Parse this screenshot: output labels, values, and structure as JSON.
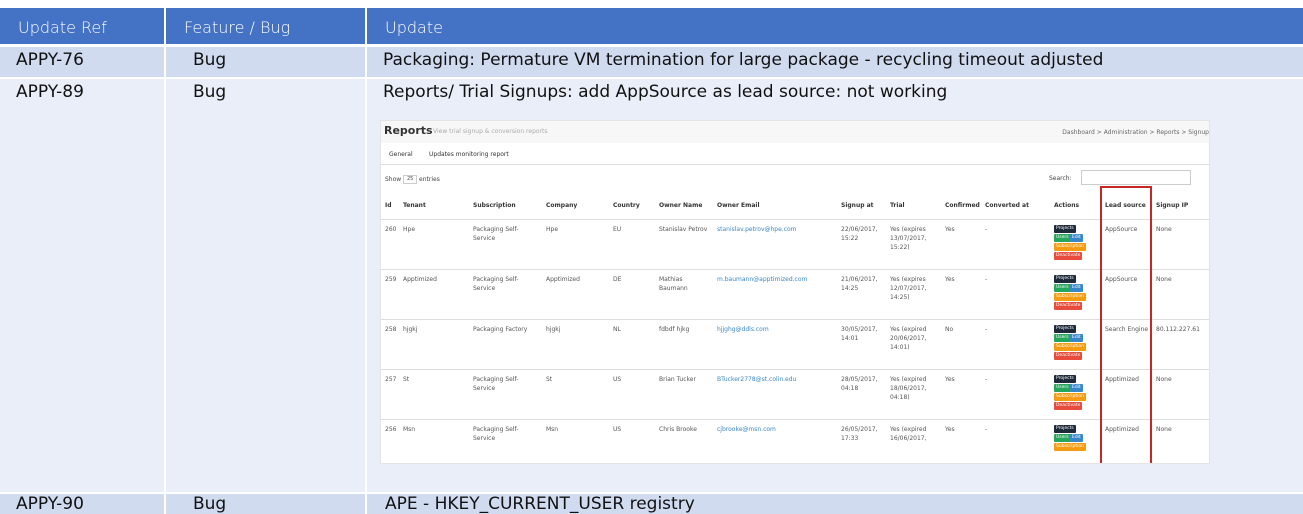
{
  "headers": [
    "Update Ref",
    "Feature / Bug",
    "Update"
  ],
  "rows": [
    {
      "ref": "APPY-76",
      "type": "Bug",
      "update": "Packaging: Permature VM termination for large package  - recycling timeout adjusted"
    },
    {
      "ref": "APPY-89",
      "type": "Bug",
      "update": "Reports/ Trial Signups: add AppSource as lead source: not working"
    },
    {
      "ref": "APPY-90",
      "type": "Bug",
      "update": "APE - HKEY_CURRENT_USER registry"
    }
  ],
  "screenshot": {
    "title": "Reports",
    "subtitle": "View trial signup & conversion reports",
    "breadcrumb": "Dashboard  >  Administration  >  Reports  >  Signup",
    "tabs": [
      "General",
      "Updates monitoring report"
    ],
    "show_label": "Show",
    "show_value": "25",
    "entries_label": "entries",
    "search_label": "Search:",
    "columns": [
      "Id",
      "Tenant",
      "Subscription",
      "Company",
      "Country",
      "Owner Name",
      "Owner Email",
      "Signup at",
      "Trial",
      "Confirmed",
      "Converted at",
      "Actions",
      "Lead source",
      "Signup IP"
    ],
    "buttons": {
      "projects": "Projects",
      "users": "Users",
      "edit": "Edit",
      "subscription": "Subscription",
      "deactivate": "Deactivate"
    },
    "records": [
      {
        "id": "260",
        "tenant": "Hpe",
        "subscription": "Packaging Self-Service",
        "company": "Hpe",
        "country": "EU",
        "owner": "Stanislav Petrov",
        "email": "stanislav.petrov@hpe.com",
        "signup": "22/06/2017, 15:22",
        "trial": "Yes (expires 13/07/2017, 15:22)",
        "confirmed": "Yes",
        "converted": "-",
        "lead": "AppSource",
        "ip": "None"
      },
      {
        "id": "259",
        "tenant": "Apptimized",
        "subscription": "Packaging Self-Service",
        "company": "Apptimized",
        "country": "DE",
        "owner": "Mathias Baumann",
        "email": "m.baumann@apptimized.com",
        "signup": "21/06/2017, 14:25",
        "trial": "Yes (expires 12/07/2017, 14:25)",
        "confirmed": "Yes",
        "converted": "-",
        "lead": "AppSource",
        "ip": "None"
      },
      {
        "id": "258",
        "tenant": "hjgkj",
        "subscription": "Packaging Factory",
        "company": "hjgkj",
        "country": "NL",
        "owner": "fdbdf hjkg",
        "email": "hjjghg@ddls.com",
        "signup": "30/05/2017, 14:01",
        "trial": "Yes (expired 20/06/2017, 14:01)",
        "confirmed": "No",
        "converted": "-",
        "lead": "Search Engine",
        "ip": "80.112.227.61"
      },
      {
        "id": "257",
        "tenant": "St",
        "subscription": "Packaging Self-Service",
        "company": "St",
        "country": "US",
        "owner": "Brian Tucker",
        "email": "BTucker2778@st.colin.edu",
        "signup": "28/05/2017, 04:18",
        "trial": "Yes (expired 18/06/2017, 04:18)",
        "confirmed": "Yes",
        "converted": "-",
        "lead": "Apptimized",
        "ip": "None"
      },
      {
        "id": "256",
        "tenant": "Msn",
        "subscription": "Packaging Self-Service",
        "company": "Msn",
        "country": "US",
        "owner": "Chris Brooke",
        "email": "cjbrooke@msn.com",
        "signup": "26/05/2017, 17:33",
        "trial": "Yes (expired 16/06/2017,",
        "confirmed": "Yes",
        "converted": "-",
        "lead": "Apptimized",
        "ip": "None"
      }
    ]
  },
  "colors": {
    "header_bg": "#4472c4",
    "row_bg": "#d9e2f3",
    "highlight": "#c62828"
  }
}
